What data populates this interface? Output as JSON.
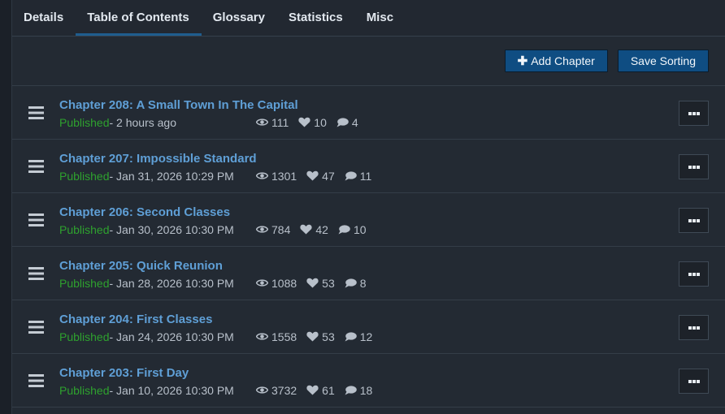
{
  "tabs": [
    {
      "label": "Details"
    },
    {
      "label": "Table of Contents"
    },
    {
      "label": "Glossary"
    },
    {
      "label": "Statistics"
    },
    {
      "label": "Misc"
    }
  ],
  "toolbar": {
    "add_chapter_label": "Add Chapter",
    "save_sorting_label": "Save Sorting"
  },
  "chapters": [
    {
      "title": "Chapter 208: A Small Town In The Capital",
      "status": "Published",
      "date": " - 2 hours ago",
      "views": "111",
      "likes": "10",
      "comments": "4"
    },
    {
      "title": "Chapter 207: Impossible Standard",
      "status": "Published",
      "date": " - Jan 31, 2026 10:29 PM",
      "views": "1301",
      "likes": "47",
      "comments": "11"
    },
    {
      "title": "Chapter 206: Second Classes",
      "status": "Published",
      "date": " - Jan 30, 2026 10:30 PM",
      "views": "784",
      "likes": "42",
      "comments": "10"
    },
    {
      "title": "Chapter 205: Quick Reunion",
      "status": "Published",
      "date": " - Jan 28, 2026 10:30 PM",
      "views": "1088",
      "likes": "53",
      "comments": "8"
    },
    {
      "title": "Chapter 204: First Classes",
      "status": "Published",
      "date": " - Jan 24, 2026 10:30 PM",
      "views": "1558",
      "likes": "53",
      "comments": "12"
    },
    {
      "title": "Chapter 203: First Day",
      "status": "Published",
      "date": " - Jan 10, 2026 10:30 PM",
      "views": "3732",
      "likes": "61",
      "comments": "18"
    }
  ],
  "colors": {
    "accent": "#1f5d8e",
    "link": "#5f9fd6",
    "published": "#2ea12e",
    "button": "#0f4d82"
  },
  "icons": {
    "add": "plus-icon",
    "drag": "drag-handle-icon",
    "views": "eye-icon",
    "likes": "heart-icon",
    "comments": "comment-icon",
    "menu": "ellipsis-icon"
  }
}
